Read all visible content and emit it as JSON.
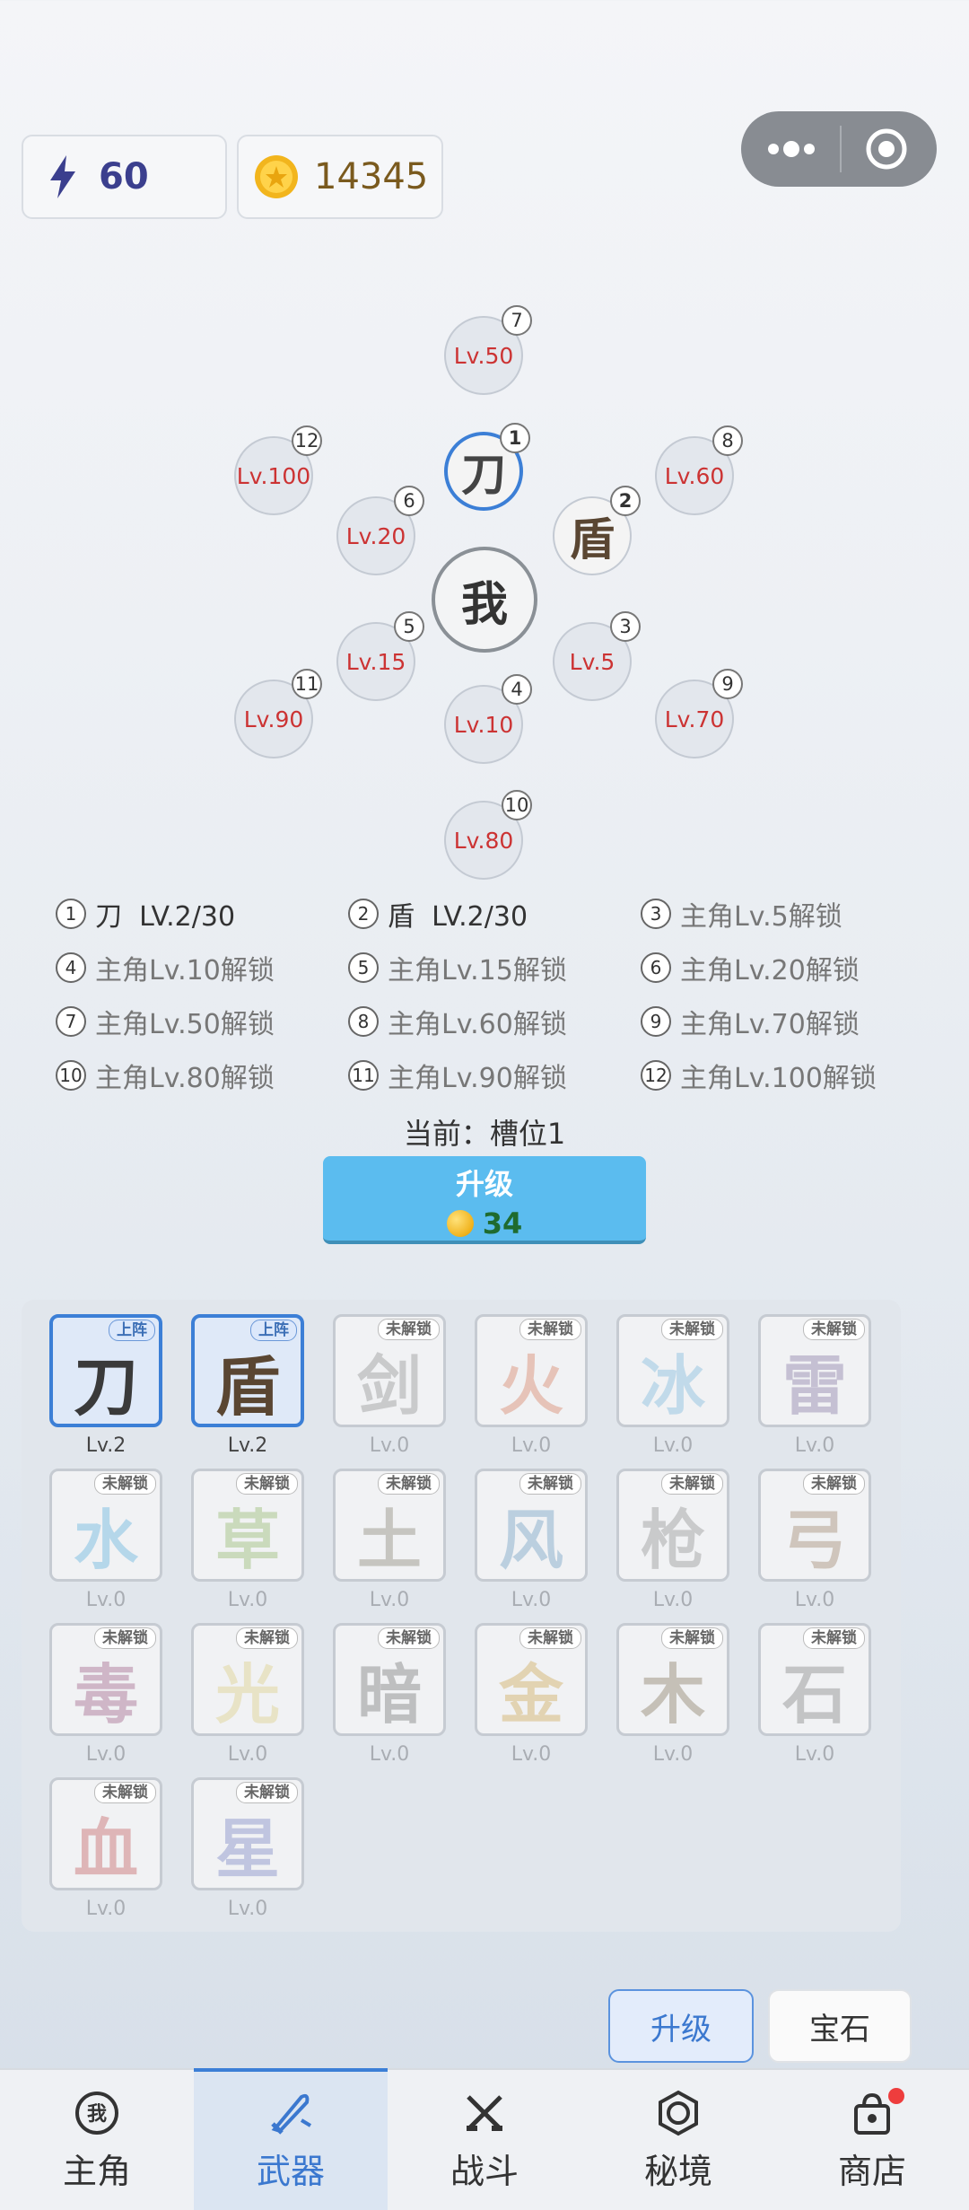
{
  "resources": {
    "energy": "60",
    "coins": "14345"
  },
  "formation": {
    "center": "我",
    "slots": [
      {
        "num": "1",
        "text": "刀"
      },
      {
        "num": "2",
        "text": "盾"
      },
      {
        "num": "3",
        "text": "Lv.5"
      },
      {
        "num": "4",
        "text": "Lv.10"
      },
      {
        "num": "5",
        "text": "Lv.15"
      },
      {
        "num": "6",
        "text": "Lv.20"
      },
      {
        "num": "7",
        "text": "Lv.50"
      },
      {
        "num": "8",
        "text": "Lv.60"
      },
      {
        "num": "9",
        "text": "Lv.70"
      },
      {
        "num": "10",
        "text": "Lv.80"
      },
      {
        "num": "11",
        "text": "Lv.90"
      },
      {
        "num": "12",
        "text": "Lv.100"
      }
    ]
  },
  "legend": [
    {
      "num": "1",
      "text": "刀  LV.2/30"
    },
    {
      "num": "2",
      "text": "盾  LV.2/30"
    },
    {
      "num": "3",
      "text": "主角Lv.5解锁"
    },
    {
      "num": "4",
      "text": "主角Lv.10解锁"
    },
    {
      "num": "5",
      "text": "主角Lv.15解锁"
    },
    {
      "num": "6",
      "text": "主角Lv.20解锁"
    },
    {
      "num": "7",
      "text": "主角Lv.50解锁"
    },
    {
      "num": "8",
      "text": "主角Lv.60解锁"
    },
    {
      "num": "9",
      "text": "主角Lv.70解锁"
    },
    {
      "num": "10",
      "text": "主角Lv.80解锁"
    },
    {
      "num": "11",
      "text": "主角Lv.90解锁"
    },
    {
      "num": "12",
      "text": "主角Lv.100解锁"
    }
  ],
  "current": "当前：槽位1",
  "upgrade": {
    "label": "升级",
    "cost": "34"
  },
  "weapons": [
    {
      "name": "刀",
      "badge": "上阵",
      "level": "Lv.2"
    },
    {
      "name": "盾",
      "badge": "上阵",
      "level": "Lv.2"
    },
    {
      "name": "剑",
      "badge": "未解锁",
      "level": "Lv.0"
    },
    {
      "name": "火",
      "badge": "未解锁",
      "level": "Lv.0"
    },
    {
      "name": "冰",
      "badge": "未解锁",
      "level": "Lv.0"
    },
    {
      "name": "雷",
      "badge": "未解锁",
      "level": "Lv.0"
    },
    {
      "name": "水",
      "badge": "未解锁",
      "level": "Lv.0"
    },
    {
      "name": "草",
      "badge": "未解锁",
      "level": "Lv.0"
    },
    {
      "name": "土",
      "badge": "未解锁",
      "level": "Lv.0"
    },
    {
      "name": "风",
      "badge": "未解锁",
      "level": "Lv.0"
    },
    {
      "name": "枪",
      "badge": "未解锁",
      "level": "Lv.0"
    },
    {
      "name": "弓",
      "badge": "未解锁",
      "level": "Lv.0"
    },
    {
      "name": "毒",
      "badge": "未解锁",
      "level": "Lv.0"
    },
    {
      "name": "光",
      "badge": "未解锁",
      "level": "Lv.0"
    },
    {
      "name": "暗",
      "badge": "未解锁",
      "level": "Lv.0"
    },
    {
      "name": "金",
      "badge": "未解锁",
      "level": "Lv.0"
    },
    {
      "name": "木",
      "badge": "未解锁",
      "level": "Lv.0"
    },
    {
      "name": "石",
      "badge": "未解锁",
      "level": "Lv.0"
    },
    {
      "name": "血",
      "badge": "未解锁",
      "level": "Lv.0"
    },
    {
      "name": "星",
      "badge": "未解锁",
      "level": "Lv.0"
    }
  ],
  "sub_tabs": {
    "upgrade": "升级",
    "gem": "宝石"
  },
  "nav": [
    {
      "label": "主角",
      "icon": "character-icon"
    },
    {
      "label": "武器",
      "icon": "weapon-icon"
    },
    {
      "label": "战斗",
      "icon": "battle-icon"
    },
    {
      "label": "秘境",
      "icon": "realm-icon"
    },
    {
      "label": "商店",
      "icon": "shop-icon"
    }
  ],
  "colors": {
    "accent": "#3c7fd6",
    "upgrade_button": "#5bbcef",
    "locked_slot_text": "#cc3333"
  }
}
